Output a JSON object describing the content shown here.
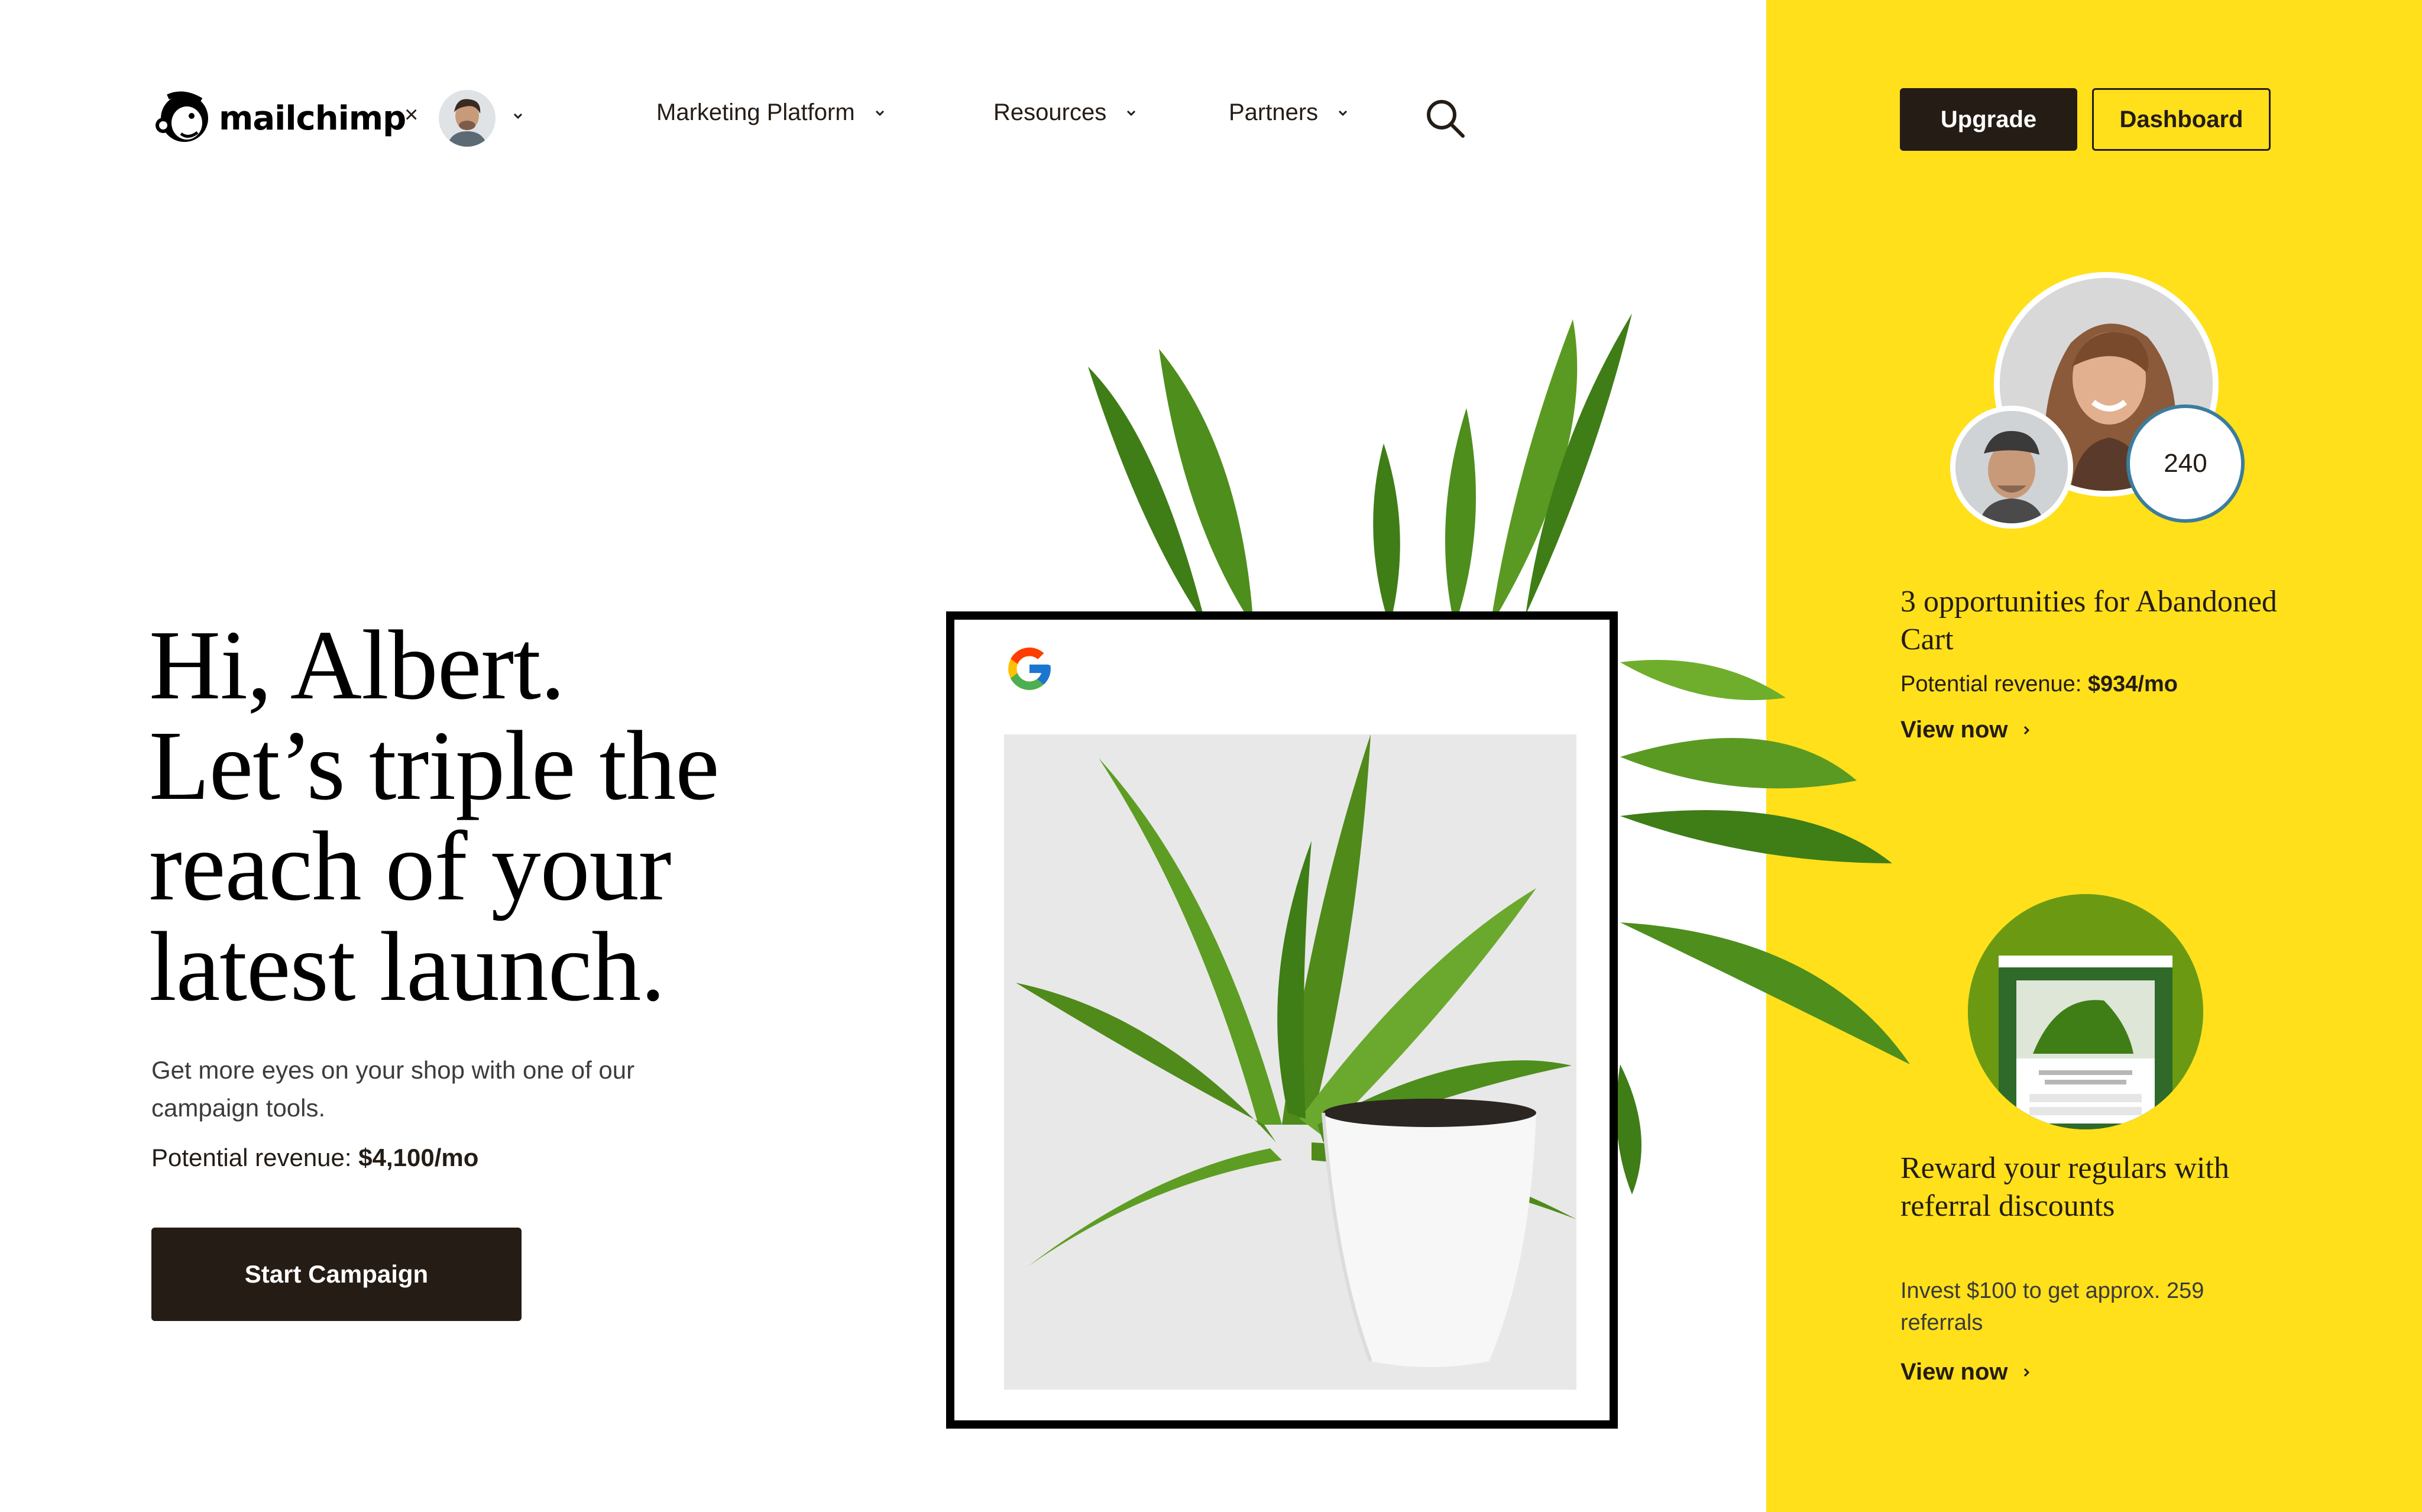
{
  "header": {
    "brand_name": "mailchimp",
    "brand_times": "×",
    "nav": [
      {
        "label": "Marketing Platform"
      },
      {
        "label": "Resources"
      },
      {
        "label": "Partners"
      }
    ],
    "upgrade_label": "Upgrade",
    "dashboard_label": "Dashboard",
    "icons": [
      "mailchimp-logo-icon",
      "chevron-down-icon",
      "search-icon"
    ]
  },
  "hero": {
    "title_lines": [
      "Hi, Albert.",
      "Let’s triple the",
      "reach of your",
      "latest launch."
    ],
    "description": "Get more eyes on your shop with one of our campaign tools.",
    "revenue_label": "Potential revenue: ",
    "revenue_value": "$4,100/mo",
    "cta_label": "Start Campaign"
  },
  "ad_preview": {
    "icons": [
      "google-icon",
      "plant-image"
    ]
  },
  "side": {
    "card1": {
      "count": "240",
      "title": "3 opportunities for Abandoned Cart",
      "revenue_label": "Potential revenue: ",
      "revenue_value": "$934/mo",
      "link_label": "View now"
    },
    "card2": {
      "title": "Reward your regulars with referral discounts",
      "description": "Invest $100 to get approx. 259 referrals",
      "link_label": "View now"
    }
  },
  "colors": {
    "accent_yellow": "#ffe01b",
    "dark": "#241c15",
    "plant_green": "#4f8a1a",
    "badge_ring": "#3c7c9c"
  }
}
